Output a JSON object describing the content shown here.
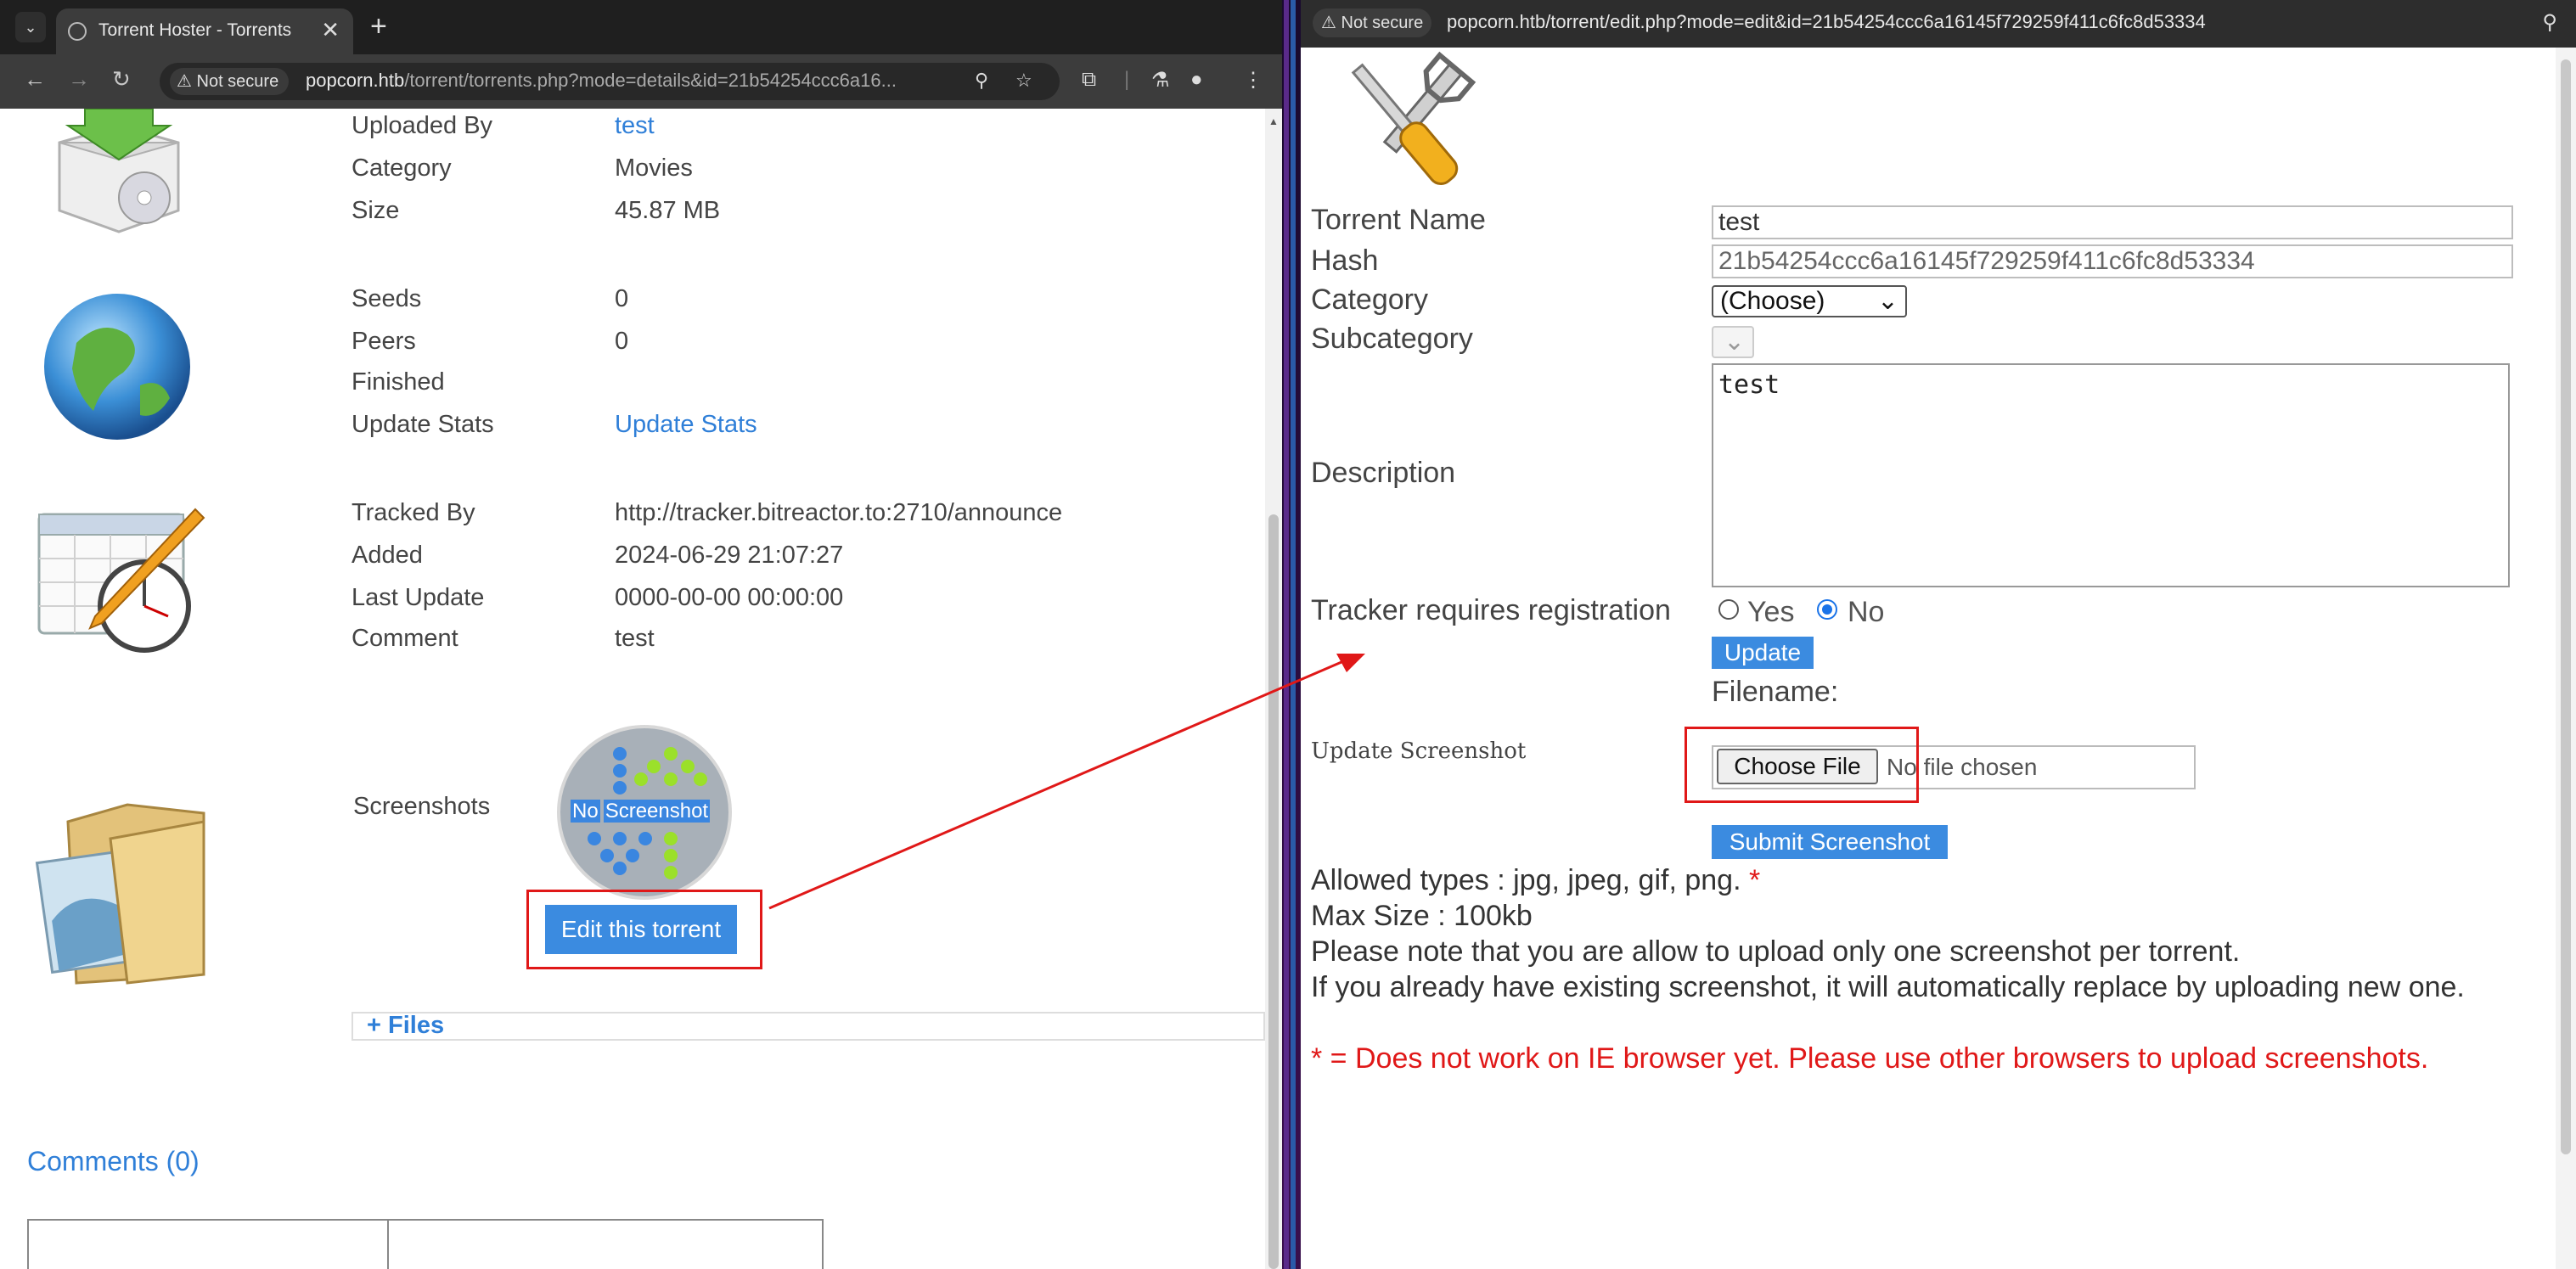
{
  "left_browser": {
    "tab_title": "Torrent Hoster - Torrents",
    "new_tab_label": "+",
    "close_tab_label": "✕",
    "not_secure_label": "Not secure",
    "url_main": "popcorn.htb",
    "url_rest": "/torrent/torrents.php?mode=details&id=21b54254ccc6a16..."
  },
  "details": {
    "uploaded_by_label": "Uploaded By",
    "uploaded_by_value": "test",
    "category_label": "Category",
    "category_value": "Movies",
    "size_label": "Size",
    "size_value": "45.87 MB",
    "seeds_label": "Seeds",
    "seeds_value": "0",
    "peers_label": "Peers",
    "peers_value": "0",
    "finished_label": "Finished",
    "update_stats_label": "Update Stats",
    "update_stats_link": "Update Stats",
    "tracked_by_label": "Tracked By",
    "tracked_by_value": "http://tracker.bitreactor.to:2710/announce",
    "added_label": "Added",
    "added_value": "2024-06-29 21:07:27",
    "last_update_label": "Last Update",
    "last_update_value": "0000-00-00 00:00:00",
    "comment_label": "Comment",
    "comment_value": "test",
    "screenshots_label": "Screenshots",
    "no_screenshot_no": "No",
    "no_screenshot_text": "Screenshot",
    "edit_button": "Edit this torrent",
    "files_toggle": "+ Files",
    "comments_heading": "Comments (0)"
  },
  "right_browser": {
    "not_secure_label": "Not secure",
    "url": "popcorn.htb/torrent/edit.php?mode=edit&id=21b54254ccc6a16145f729259f411c6fc8d53334"
  },
  "edit_form": {
    "torrent_name_label": "Torrent Name",
    "torrent_name_value": "test",
    "hash_label": "Hash",
    "hash_value": "21b54254ccc6a16145f729259f411c6fc8d53334",
    "category_label": "Category",
    "category_selected": "(Choose)",
    "subcategory_label": "Subcategory",
    "description_label": "Description",
    "description_value": "test",
    "tracker_reg_label": "Tracker requires registration",
    "yes_label": "Yes",
    "no_label": "No",
    "update_button": "Update",
    "filename_label": "Filename:",
    "update_screenshot_label": "Update Screenshot",
    "choose_file_button": "Choose File",
    "no_file_text": "No file chosen",
    "submit_button": "Submit Screenshot",
    "allowed_types": "Allowed types : jpg, jpeg, gif, png.",
    "asterisk": "*",
    "max_size": "Max Size : 100kb",
    "note_one": "Please note that you are allow to upload only one screenshot per torrent.",
    "note_replace": "If you already have existing screenshot, it will automatically replace by uploading new one.",
    "ie_warning": "* = Does not work on IE browser yet. Please use other browsers to upload screenshots."
  },
  "colors": {
    "link": "#2f7fd8",
    "button": "#3b8be0",
    "annotation_red": "#e01818"
  }
}
